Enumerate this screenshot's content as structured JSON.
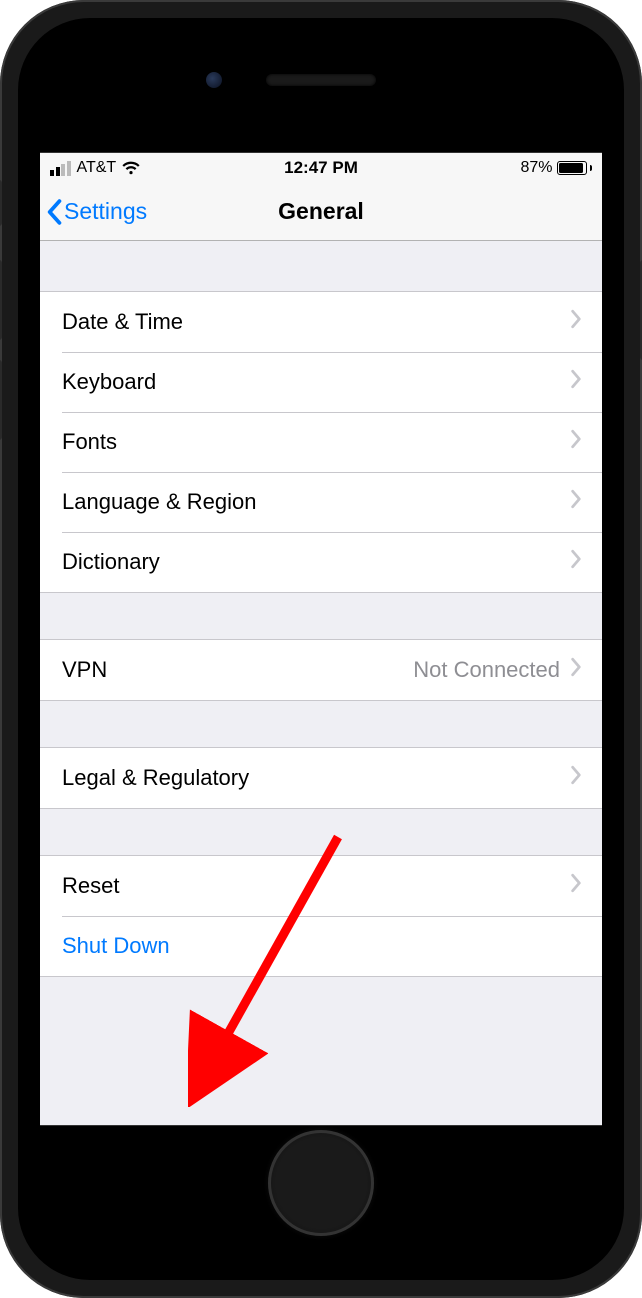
{
  "status": {
    "carrier": "AT&T",
    "time": "12:47 PM",
    "battery_pct": "87%"
  },
  "nav": {
    "back_label": "Settings",
    "title": "General"
  },
  "groups": [
    {
      "rows": [
        {
          "label": "Date & Time",
          "detail": "",
          "disclosure": true,
          "link": false
        },
        {
          "label": "Keyboard",
          "detail": "",
          "disclosure": true,
          "link": false
        },
        {
          "label": "Fonts",
          "detail": "",
          "disclosure": true,
          "link": false
        },
        {
          "label": "Language & Region",
          "detail": "",
          "disclosure": true,
          "link": false
        },
        {
          "label": "Dictionary",
          "detail": "",
          "disclosure": true,
          "link": false
        }
      ]
    },
    {
      "rows": [
        {
          "label": "VPN",
          "detail": "Not Connected",
          "disclosure": true,
          "link": false
        }
      ]
    },
    {
      "rows": [
        {
          "label": "Legal & Regulatory",
          "detail": "",
          "disclosure": true,
          "link": false
        }
      ]
    },
    {
      "rows": [
        {
          "label": "Reset",
          "detail": "",
          "disclosure": true,
          "link": false
        },
        {
          "label": "Shut Down",
          "detail": "",
          "disclosure": false,
          "link": true
        }
      ]
    }
  ],
  "annotation": {
    "arrow_color": "#ff0000"
  }
}
